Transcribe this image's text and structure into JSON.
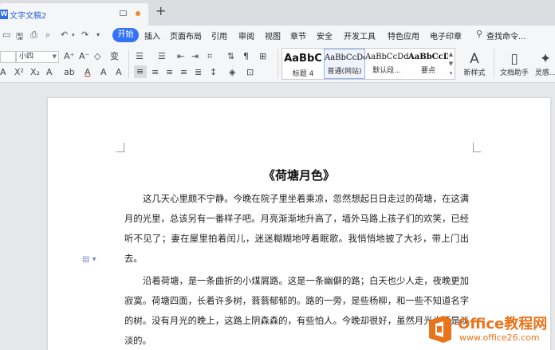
{
  "app": {
    "doc_tab_title": "文字文稿2",
    "logo_letter": "W",
    "new_tab": "+"
  },
  "menu": {
    "items": [
      "开始",
      "插入",
      "页面布局",
      "引用",
      "审阅",
      "视图",
      "章节",
      "安全",
      "开发工具",
      "特色应用",
      "电子印章"
    ],
    "search": "查找命令..."
  },
  "ribbon": {
    "font_name": "",
    "font_size": "小四",
    "styles": [
      {
        "sample": "AaBbC",
        "name": "标题 4"
      },
      {
        "sample": "AaBbCcDd",
        "name": "普通(网站)"
      },
      {
        "sample": "AaBbCcDd",
        "name": "默认段..."
      },
      {
        "sample": "AaBbCcDd",
        "name": "要点"
      }
    ],
    "new_style": "新样式",
    "doc_assistant": "文档助手",
    "inspiration": "灵感..."
  },
  "document": {
    "title": "《荷塘月色》",
    "paragraphs": [
      "这几天心里颇不宁静。今晚在院子里坐着乘凉，忽然想起日日走过的荷塘，在这满月的光里，总该另有一番样子吧。月亮渐渐地升高了，墙外马路上孩子们的欢笑，已经听不见了；妻在屋里拍着闰儿，迷迷糊糊地哼着眠歌。我悄悄地披了大衫，带上门出去。",
      "沿着荷塘，是一条曲折的小煤屑路。这是一条幽僻的路；白天也少人走，夜晚更加寂寞。荷塘四面，长着许多树，蓊蓊郁郁的。路的一旁，是些杨柳，和一些不知道名字的树。没有月光的晚上，这路上阴森森的，有些怕人。今晚却很好，虽然月光也还是淡淡的。"
    ]
  },
  "watermark": {
    "brand": "Office教程网",
    "url": "www.office26.com"
  },
  "colors": {
    "accent": "#3473f5",
    "watermark": "#e8741c"
  }
}
